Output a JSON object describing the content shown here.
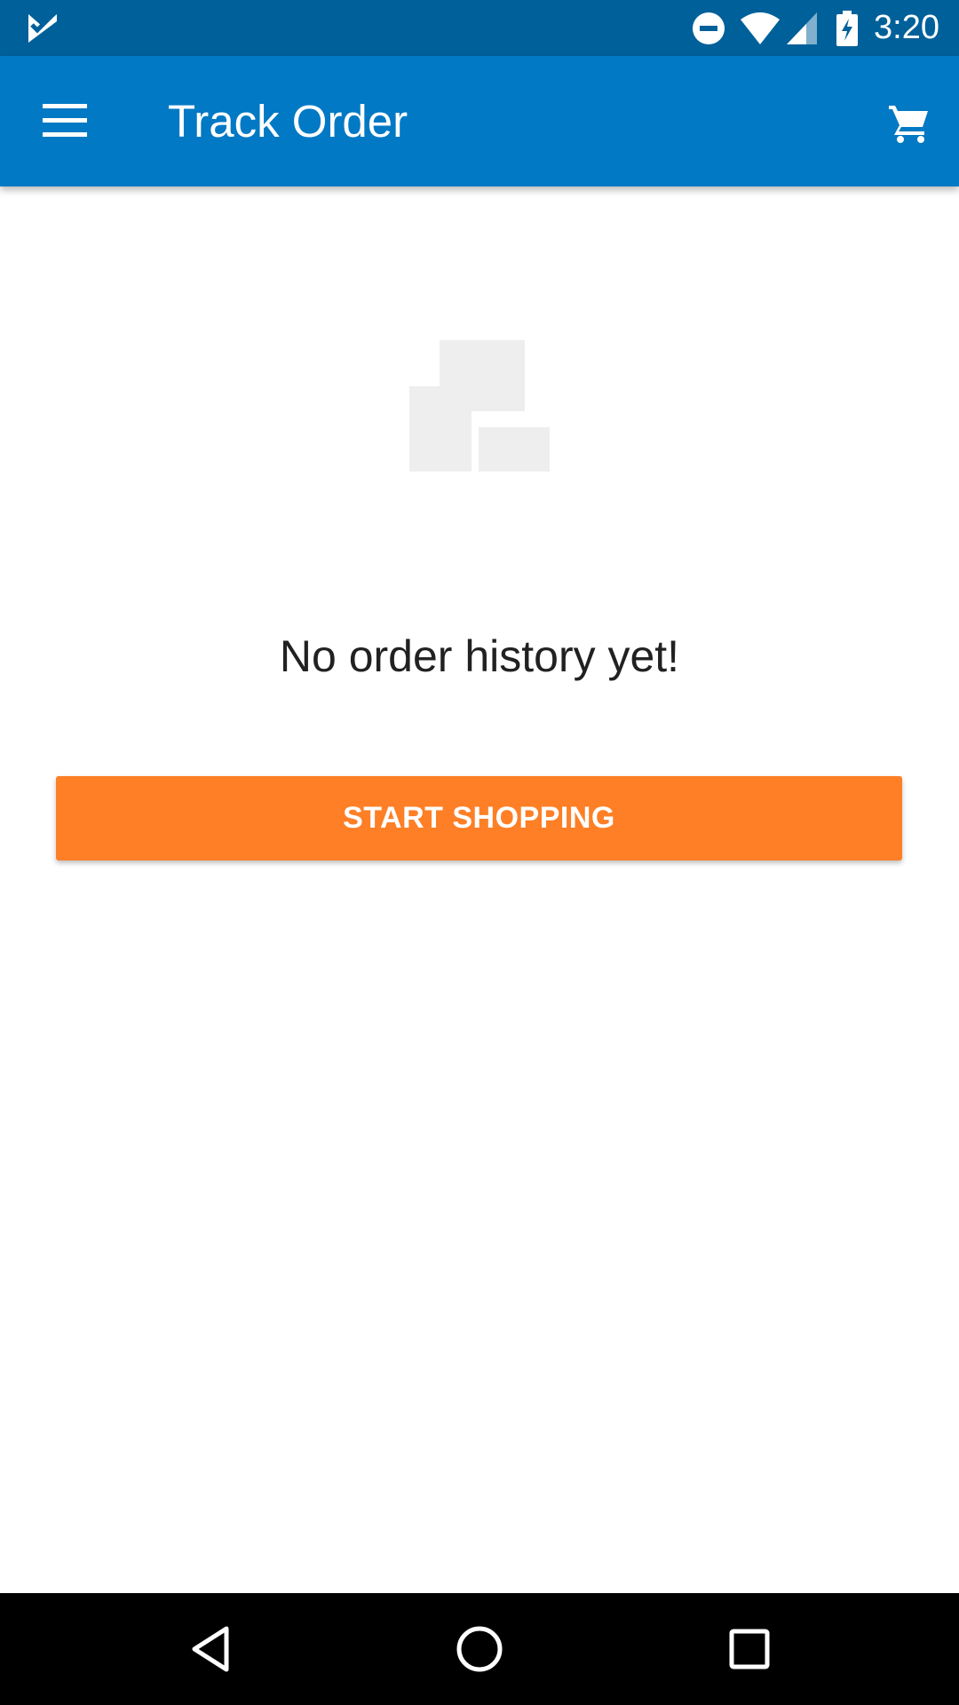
{
  "status_bar": {
    "time": "3:20",
    "icons": [
      "app-check-notification-icon",
      "do-not-disturb-icon",
      "wifi-icon",
      "cell-signal-icon",
      "battery-charging-icon"
    ]
  },
  "app_bar": {
    "title": "Track Order",
    "menu_icon": "menu-icon",
    "cart_icon": "cart-icon"
  },
  "empty_state": {
    "illustration_icon": "empty-orders-icon",
    "message": "No order history yet!",
    "button_label": "START SHOPPING"
  },
  "nav_bar": {
    "icons": [
      "back-icon",
      "home-icon",
      "recents-icon"
    ]
  },
  "colors": {
    "status_bar": "#00609a",
    "app_bar": "#0279c4",
    "accent_button": "#fe7f26",
    "illustration": "#eeeeee",
    "message_text": "#212121",
    "nav_bar": "#000000"
  }
}
